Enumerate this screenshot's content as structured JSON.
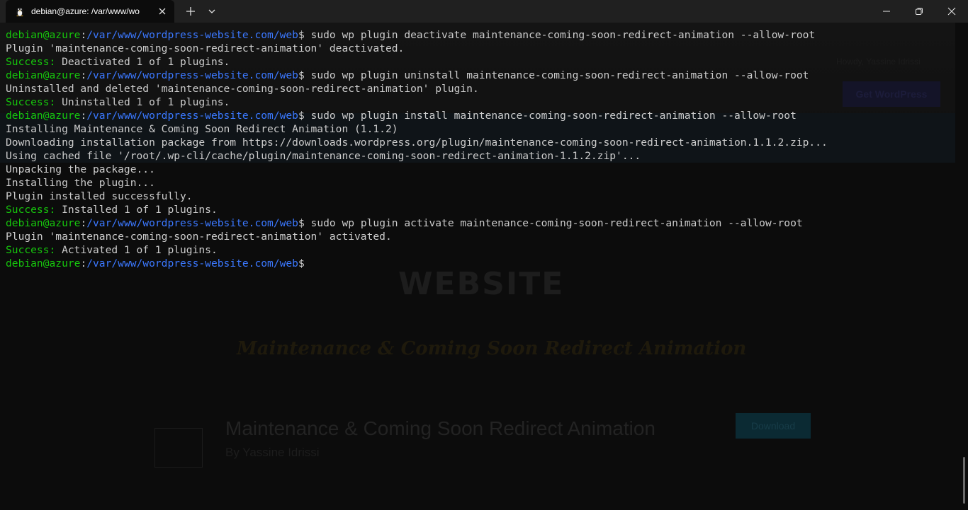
{
  "tab": {
    "title": "debian@azure: /var/www/wo"
  },
  "icons": {
    "tab": "tux-linux-icon",
    "close": "close-icon",
    "new_tab": "plus-icon",
    "dropdown": "chevron-down-icon"
  },
  "colors": {
    "prompt_user": "#16c60c",
    "prompt_path": "#3b78ff",
    "text": "#cccccc",
    "background": "#0c0c0c"
  },
  "terminal": {
    "prompt_user": "debian@azure",
    "prompt_sep": ":",
    "prompt_path": "/var/www/wordpress-website.com/web",
    "prompt_symbol": "$",
    "lines": [
      {
        "type": "cmd",
        "text": " sudo wp plugin deactivate maintenance-coming-soon-redirect-animation --allow-root"
      },
      {
        "type": "out",
        "text": "Plugin 'maintenance-coming-soon-redirect-animation' deactivated."
      },
      {
        "type": "success",
        "label": "Success:",
        "text": " Deactivated 1 of 1 plugins."
      },
      {
        "type": "cmd",
        "text": " sudo wp plugin uninstall maintenance-coming-soon-redirect-animation --allow-root"
      },
      {
        "type": "out",
        "text": "Uninstalled and deleted 'maintenance-coming-soon-redirect-animation' plugin."
      },
      {
        "type": "success",
        "label": "Success:",
        "text": " Uninstalled 1 of 1 plugins."
      },
      {
        "type": "cmd",
        "text": " sudo wp plugin install maintenance-coming-soon-redirect-animation --allow-root"
      },
      {
        "type": "out",
        "text": "Installing Maintenance & Coming Soon Redirect Animation (1.1.2)"
      },
      {
        "type": "out",
        "text": "Downloading installation package from https://downloads.wordpress.org/plugin/maintenance-coming-soon-redirect-animation.1.1.2.zip..."
      },
      {
        "type": "out",
        "text": "Using cached file '/root/.wp-cli/cache/plugin/maintenance-coming-soon-redirect-animation-1.1.2.zip'..."
      },
      {
        "type": "out",
        "text": "Unpacking the package..."
      },
      {
        "type": "out",
        "text": "Installing the plugin..."
      },
      {
        "type": "out",
        "text": "Plugin installed successfully."
      },
      {
        "type": "success",
        "label": "Success:",
        "text": " Installed 1 of 1 plugins."
      },
      {
        "type": "cmd",
        "text": " sudo wp plugin activate maintenance-coming-soon-redirect-animation --allow-root"
      },
      {
        "type": "out",
        "text": "Plugin 'maintenance-coming-soon-redirect-animation' activated."
      },
      {
        "type": "success",
        "label": "Success:",
        "text": " Activated 1 of 1 plugins."
      },
      {
        "type": "cmd",
        "text": ""
      }
    ]
  },
  "background_page": {
    "howdy": "Howdy, Yassine Idrissi",
    "get_wordpress": "Get WordPress",
    "logo": "WEBSITE",
    "subtitle": "Maintenance & Coming Soon Redirect Animation",
    "plugin_title": "Maintenance & Coming Soon Redirect Animation",
    "author": "By Yassine Idrissi",
    "download": "Download"
  }
}
